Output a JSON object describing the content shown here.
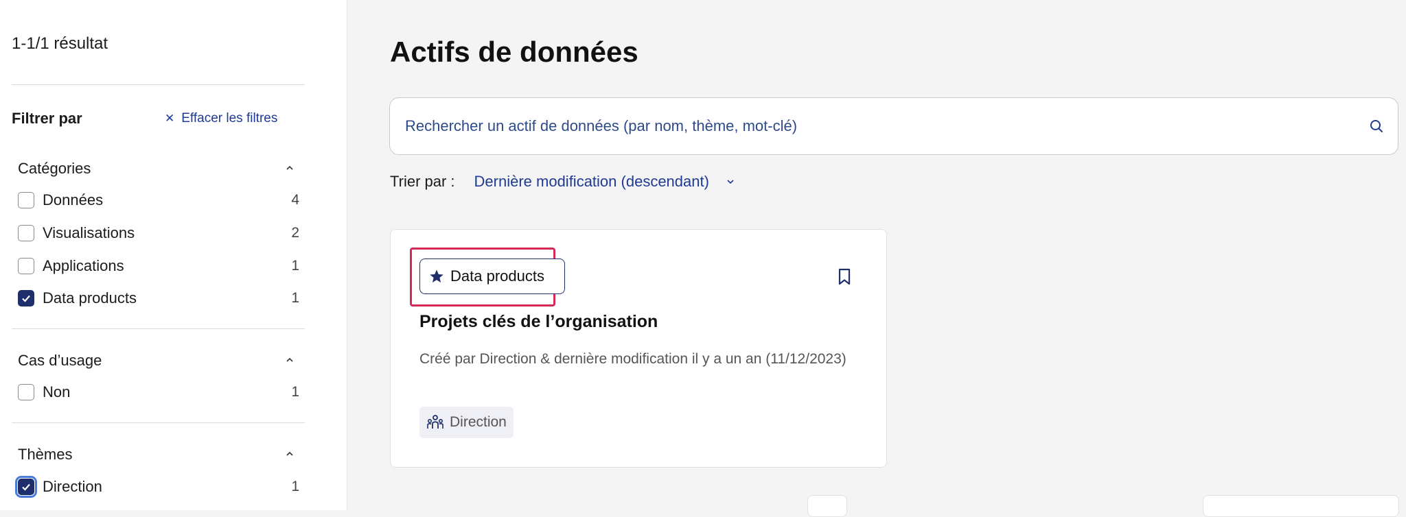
{
  "sidebar": {
    "results": "1-1/1 résultat",
    "filter_title": "Filtrer par",
    "clear_filters": "Effacer les filtres",
    "categories": {
      "title": "Catégories",
      "items": [
        {
          "label": "Données",
          "count": "4",
          "checked": false
        },
        {
          "label": "Visualisations",
          "count": "2",
          "checked": false
        },
        {
          "label": "Applications",
          "count": "1",
          "checked": false
        },
        {
          "label": "Data products",
          "count": "1",
          "checked": true
        }
      ]
    },
    "use_cases": {
      "title": "Cas d’usage",
      "items": [
        {
          "label": "Non",
          "count": "1",
          "checked": false
        }
      ]
    },
    "themes": {
      "title": "Thèmes",
      "items": [
        {
          "label": "Direction",
          "count": "1",
          "checked": true
        }
      ]
    }
  },
  "main": {
    "title": "Actifs de données",
    "search_placeholder": "Rechercher un actif de données (par nom, thème, mot-clé)",
    "sort_label": "Trier par :",
    "sort_value": "Dernière modification (descendant)",
    "card": {
      "badge": "Data products",
      "title": "Projets clés de l’organisation",
      "description": "Créé par Direction & dernière modification il y a un an (11/12/2023)",
      "tag": "Direction"
    }
  },
  "colors": {
    "accent": "#1f3a93",
    "highlight": "#d62a55",
    "checkbox_checked": "#1f2f6b"
  }
}
